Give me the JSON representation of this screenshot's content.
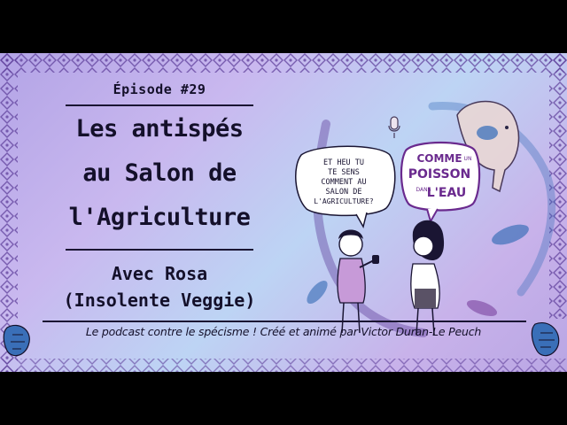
{
  "episode": "Épisode #29",
  "title": {
    "line1": "Les antispés",
    "line2": "au Salon de",
    "line3": "l'Agriculture"
  },
  "guest": {
    "line1": "Avec Rosa",
    "line2": "(Insolente Veggie)"
  },
  "speech_bubble": {
    "line1": "ET HEU TU",
    "line2": "TE SENS",
    "line3": "COMMENT AU",
    "line4": "SALON DE",
    "line5": "L'AGRICULTURE?"
  },
  "logo": {
    "line1": "COMME",
    "small1": "UN",
    "line2": "POISSON",
    "small2": "DANS",
    "line3": "L'EAU"
  },
  "footer": "Le podcast contre le spécisme ! Créé et animé par Victor Duran-Le Peuch",
  "colors": {
    "background_band": "#000000",
    "card_purple": "#b3a4e6",
    "card_blue": "#bdd4f4",
    "text_dark": "#14102a",
    "accent_purple": "#6a2a8e",
    "accent_blue": "#3a6fb8"
  }
}
